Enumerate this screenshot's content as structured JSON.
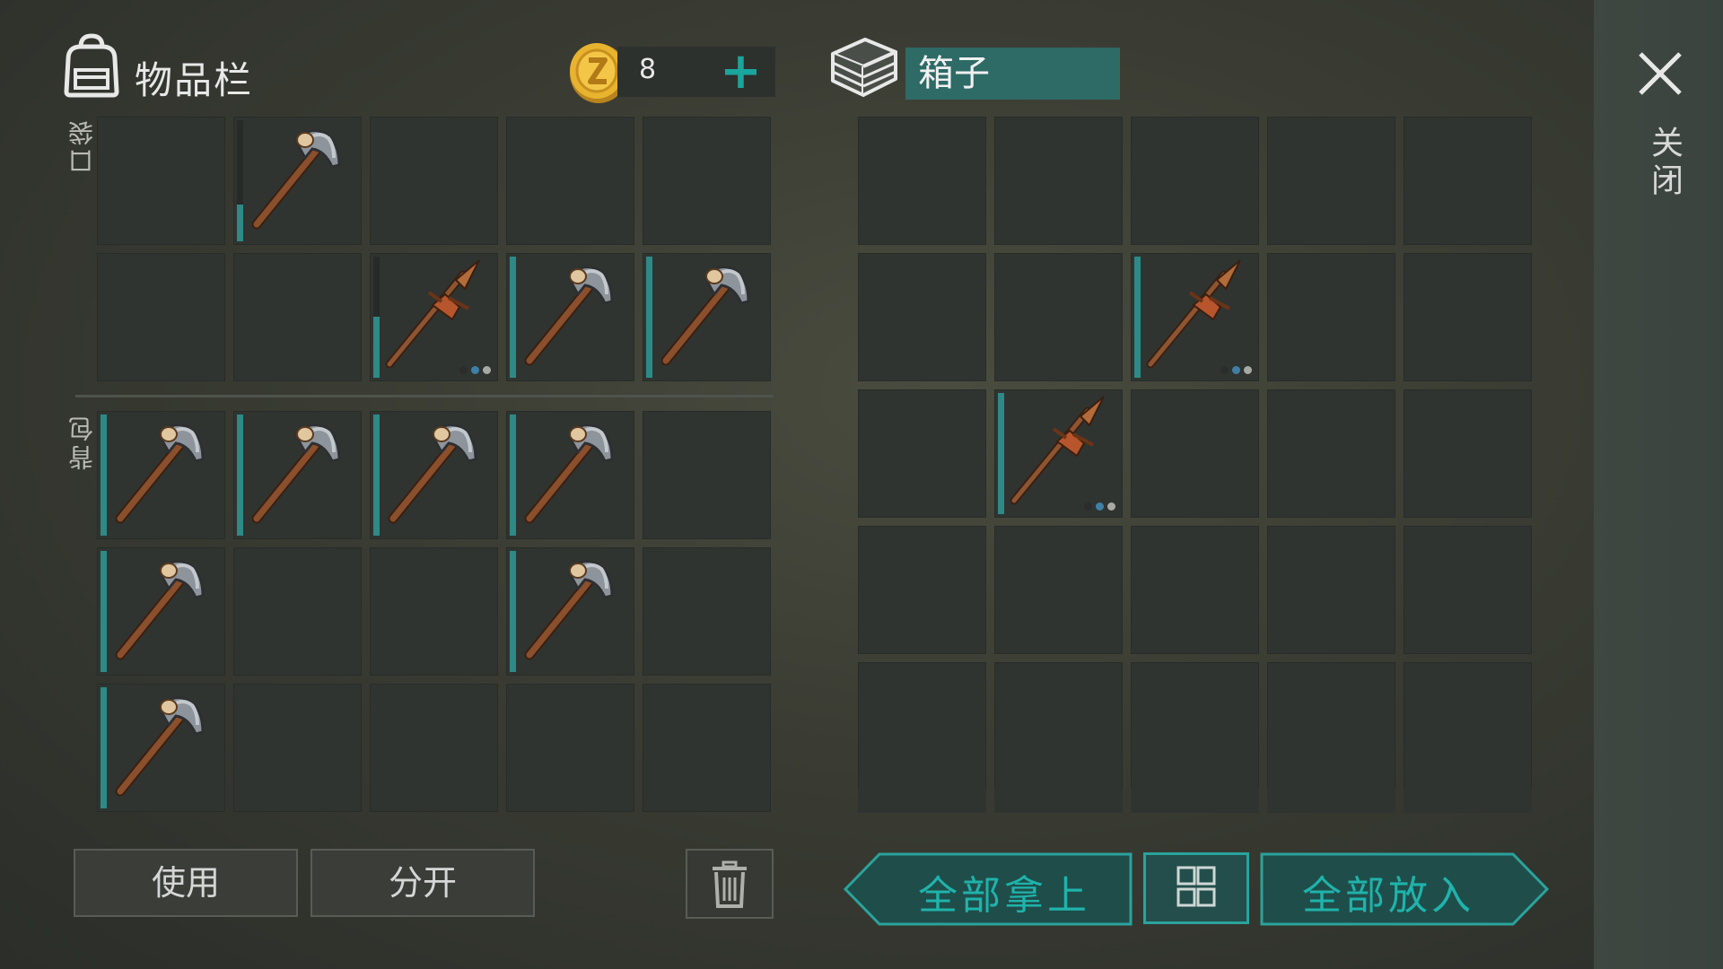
{
  "inventory": {
    "title": "物品栏",
    "pocket_label": "口袋",
    "backpack_label": "背包",
    "coins": "8",
    "pocket_slots": [
      {
        "item": null
      },
      {
        "item": "hammer",
        "durability": 0.3,
        "dots": false
      },
      {
        "item": null
      },
      {
        "item": null
      },
      {
        "item": null
      },
      {
        "item": null
      },
      {
        "item": null
      },
      {
        "item": "spear",
        "durability": 0.5,
        "dots": true
      },
      {
        "item": "hammer",
        "durability": 1.0,
        "dots": false
      },
      {
        "item": "hammer",
        "durability": 1.0,
        "dots": false
      }
    ],
    "backpack_slots": [
      {
        "item": "hammer",
        "durability": 1.0,
        "dots": false
      },
      {
        "item": "hammer",
        "durability": 1.0,
        "dots": false
      },
      {
        "item": "hammer",
        "durability": 1.0,
        "dots": false
      },
      {
        "item": "hammer",
        "durability": 1.0,
        "dots": false
      },
      {
        "item": null
      },
      {
        "item": "hammer",
        "durability": 1.0,
        "dots": false
      },
      {
        "item": null
      },
      {
        "item": null
      },
      {
        "item": "hammer",
        "durability": 1.0,
        "dots": false
      },
      {
        "item": null
      },
      {
        "item": "hammer",
        "durability": 1.0,
        "dots": false
      },
      {
        "item": null
      },
      {
        "item": null
      },
      {
        "item": null
      },
      {
        "item": null
      }
    ],
    "use_label": "使用",
    "split_label": "分开"
  },
  "chest": {
    "title": "箱子",
    "slots": [
      {
        "item": null
      },
      {
        "item": null
      },
      {
        "item": null
      },
      {
        "item": null
      },
      {
        "item": null
      },
      {
        "item": null
      },
      {
        "item": null
      },
      {
        "item": "spear",
        "durability": 1.0,
        "dots": true
      },
      {
        "item": null
      },
      {
        "item": null
      },
      {
        "item": null
      },
      {
        "item": "spear",
        "durability": 1.0,
        "dots": true
      },
      {
        "item": null
      },
      {
        "item": null
      },
      {
        "item": null
      },
      {
        "item": null
      },
      {
        "item": null
      },
      {
        "item": null
      },
      {
        "item": null
      },
      {
        "item": null
      },
      {
        "item": null
      },
      {
        "item": null
      },
      {
        "item": null
      },
      {
        "item": null
      },
      {
        "item": null
      }
    ],
    "take_all_label": "全部拿上",
    "put_all_label": "全部放入"
  },
  "close_label": "关闭",
  "colors": {
    "accent": "#1fb3ab",
    "durability": "#2d8a86",
    "dot_dark": "#2a2d2b",
    "dot_blue": "#3f7fa6",
    "dot_gray": "#a7a9a6"
  },
  "icons": {
    "backpack": "backpack-icon",
    "coin": "coin-icon",
    "chest": "crate-icon",
    "close": "close-icon",
    "trash": "trash-icon",
    "sort": "grid-icon",
    "hammer": "stone-hammer-icon",
    "spear": "spear-icon"
  }
}
